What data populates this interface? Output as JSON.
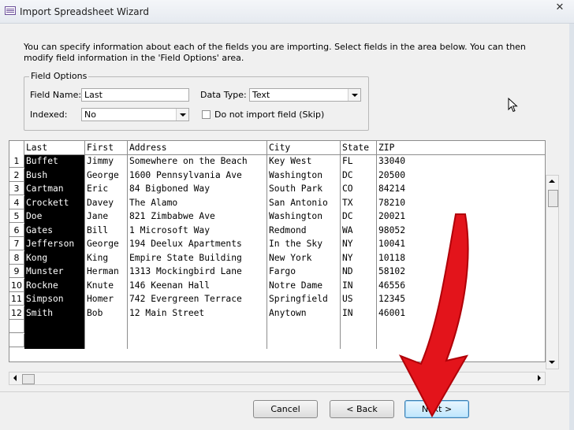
{
  "window": {
    "title": "Import Spreadsheet Wizard",
    "close_glyph": "✕"
  },
  "intro_text": "You can specify information about each of the fields you are importing. Select fields in the area below. You can then modify field information in the 'Field Options' area.",
  "field_options": {
    "legend": "Field Options",
    "field_name_label": "Field Name:",
    "field_name_value": "Last",
    "data_type_label": "Data Type:",
    "data_type_value": "Text",
    "indexed_label": "Indexed:",
    "indexed_value": "No",
    "do_not_import_label": "Do not import field (Skip)"
  },
  "grid": {
    "columns": [
      "Last",
      "First",
      "Address",
      "City",
      "State",
      "ZIP"
    ],
    "rows": [
      [
        "1",
        "Buffet",
        "Jimmy",
        "Somewhere on the Beach",
        "Key West",
        "FL",
        "33040"
      ],
      [
        "2",
        "Bush",
        "George",
        "1600 Pennsylvania Ave",
        "Washington",
        "DC",
        "20500"
      ],
      [
        "3",
        "Cartman",
        "Eric",
        "84 Bigboned Way",
        "South Park",
        "CO",
        "84214"
      ],
      [
        "4",
        "Crockett",
        "Davey",
        "The Alamo",
        "San Antonio",
        "TX",
        "78210"
      ],
      [
        "5",
        "Doe",
        "Jane",
        "821 Zimbabwe Ave",
        "Washington",
        "DC",
        "20021"
      ],
      [
        "6",
        "Gates",
        "Bill",
        "1 Microsoft Way",
        "Redmond",
        "WA",
        "98052"
      ],
      [
        "7",
        "Jefferson",
        "George",
        "194 Deelux Apartments",
        "In the Sky",
        "NY",
        "10041"
      ],
      [
        "8",
        "Kong",
        "King",
        "Empire State Building",
        "New York",
        "NY",
        "10118"
      ],
      [
        "9",
        "Munster",
        "Herman",
        "1313 Mockingbird Lane",
        "Fargo",
        "ND",
        "58102"
      ],
      [
        "10",
        "Rockne",
        "Knute",
        "146 Keenan Hall",
        "Notre Dame",
        "IN",
        "46556"
      ],
      [
        "11",
        "Simpson",
        "Homer",
        "742 Evergreen Terrace",
        "Springfield",
        "US",
        "12345"
      ],
      [
        "12",
        "Smith",
        "Bob",
        "12 Main Street",
        "Anytown",
        "IN",
        "46001"
      ]
    ]
  },
  "buttons": {
    "cancel": "Cancel",
    "back": "< Back",
    "next": "Next >"
  },
  "colors": {
    "annotation_arrow": "#e3141b",
    "selected_column": "#000000"
  },
  "icons": {
    "app": "spreadsheet-icon",
    "cursor": "mouse-pointer-icon"
  }
}
